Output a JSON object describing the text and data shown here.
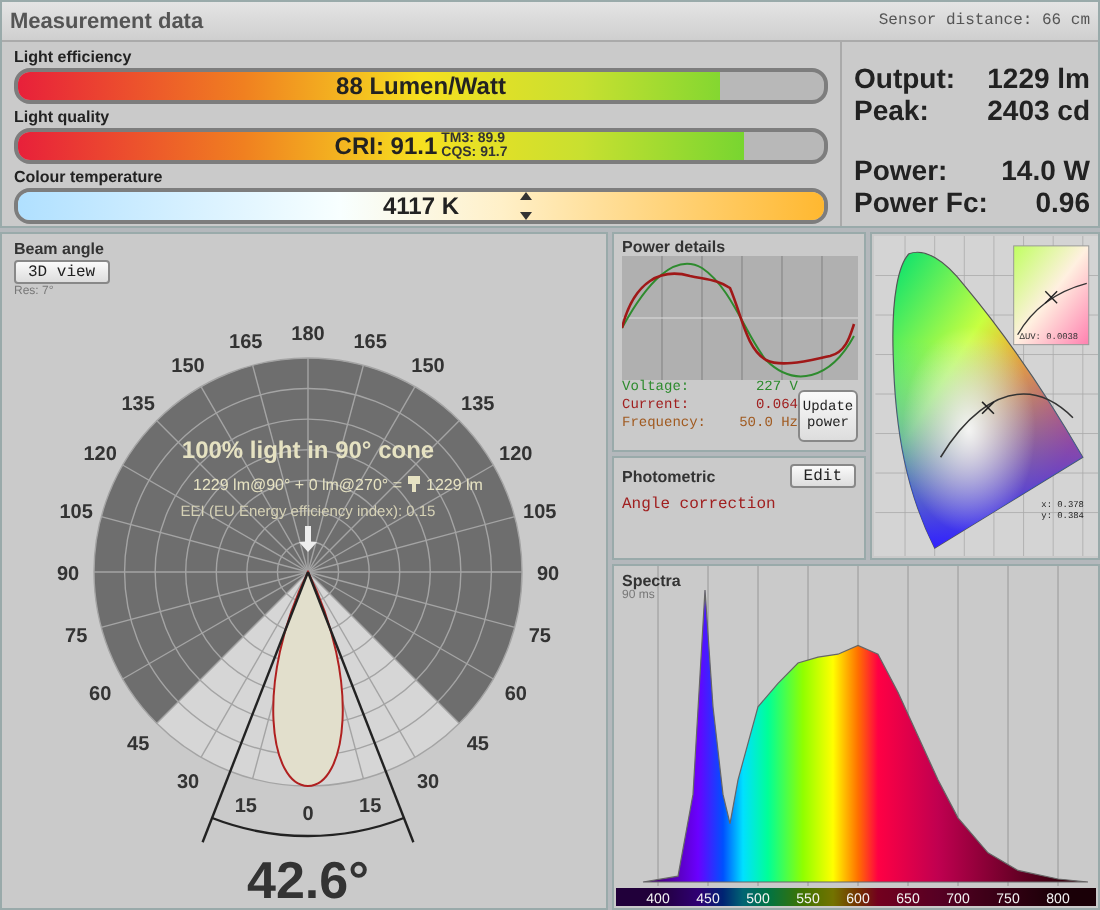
{
  "header": {
    "title": "Measurement data",
    "sensor": "Sensor distance:  66 cm"
  },
  "meters": [
    {
      "kind": "efficiency",
      "label": "Light efficiency",
      "value": "88 Lumen/Watt",
      "level": 0.87
    },
    {
      "kind": "quality",
      "label": "Light quality",
      "value": "CRI: 91.1",
      "sub": [
        "TM3: 89.9",
        "CQS: 91.7"
      ],
      "level": 0.9
    },
    {
      "kind": "temperature",
      "label": "Colour temperature",
      "value": "4117 K",
      "level": 0.63
    }
  ],
  "stats": [
    [
      {
        "label": "Output:",
        "value": "1229 lm"
      },
      {
        "label": "Peak:",
        "value": "2403 cd"
      }
    ],
    [
      {
        "label": "Power:",
        "value": "14.0 W"
      },
      {
        "label": "Power Fc:",
        "value": "0.96"
      }
    ]
  ],
  "beam": {
    "title": "Beam angle",
    "button": "3D view",
    "res": "Res: 7°",
    "angle_rows": [
      [
        "180"
      ],
      [
        "165",
        "165"
      ],
      [
        "150",
        "150"
      ],
      [
        "135",
        "135"
      ],
      [
        "120",
        "120"
      ],
      [
        "105",
        "105"
      ],
      [
        "90",
        "90"
      ],
      [
        "75",
        "75"
      ],
      [
        "60",
        "60"
      ],
      [
        "45",
        "45"
      ],
      [
        "30",
        "30"
      ],
      [
        "15",
        "15"
      ],
      [
        "0"
      ]
    ],
    "headline": "100% light in 90° cone",
    "sum_left": "1229 lm@90° + 0 lm@270° =",
    "sum_right": "1229 lm",
    "eei": "EEI (EU Energy efficiency index): 0.15",
    "angle": "42.6°"
  },
  "power": {
    "title": "Power details",
    "readings": [
      {
        "label": "Voltage:",
        "value": "227 V",
        "color": "#2e8b2e"
      },
      {
        "label": "Current:",
        "value": "0.064",
        "color": "#a02020"
      },
      {
        "label": "Frequency:",
        "value": "50.0 Hz",
        "color": "#a05a20"
      }
    ],
    "button": "Update power"
  },
  "photometric": {
    "title": "Photometric",
    "button": "Edit",
    "text": "Angle correction"
  },
  "cie": {
    "duv": "ΔUV: 0.0038",
    "x": "x: 0.378",
    "y": "y: 0.384"
  },
  "spectra": {
    "title": "Spectra",
    "time": "90 ms",
    "axis_labels": [
      "400",
      "450",
      "500",
      "550",
      "600",
      "650",
      "700",
      "750",
      "800"
    ]
  }
}
